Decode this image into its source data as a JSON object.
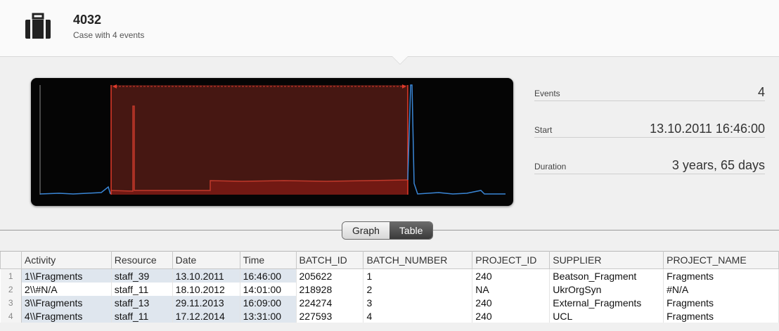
{
  "case": {
    "id": "4032",
    "subtitle": "Case with 4 events"
  },
  "stats": [
    {
      "label": "Events",
      "value": "4"
    },
    {
      "label": "Start",
      "value": "13.10.2011 16:46:00"
    },
    {
      "label": "Duration",
      "value": "3 years, 65 days"
    }
  ],
  "view_toggle": {
    "graph_label": "Graph",
    "table_label": "Table",
    "selected": "Table"
  },
  "table": {
    "columns": [
      "Activity",
      "Resource",
      "Date",
      "Time",
      "BATCH_ID",
      "BATCH_NUMBER",
      "PROJECT_ID",
      "SUPPLIER",
      "PROJECT_NAME"
    ],
    "rows": [
      {
        "num": "1",
        "cells": [
          "1\\\\Fragments",
          "staff_39",
          "13.10.2011",
          "16:46:00",
          "205622",
          "1",
          "240",
          "Beatson_Fragment",
          "Fragments"
        ]
      },
      {
        "num": "2",
        "cells": [
          "2\\\\#N/A",
          "staff_11",
          "18.10.2012",
          "14:01:00",
          "218928",
          "2",
          "NA",
          "UkrOrgSyn",
          "#N/A"
        ]
      },
      {
        "num": "3",
        "cells": [
          "3\\\\Fragments",
          "staff_13",
          "29.11.2013",
          "16:09:00",
          "224274",
          "3",
          "240",
          "External_Fragments",
          "Fragments"
        ]
      },
      {
        "num": "4",
        "cells": [
          "4\\\\Fragments",
          "staff_11",
          "17.12.2014",
          "13:31:00",
          "227593",
          "4",
          "240",
          "UCL",
          "Fragments"
        ]
      }
    ]
  },
  "colors": {
    "case_highlight": "#c0392b",
    "activity_line": "#3a86d6",
    "graph_bg": "#050505"
  }
}
